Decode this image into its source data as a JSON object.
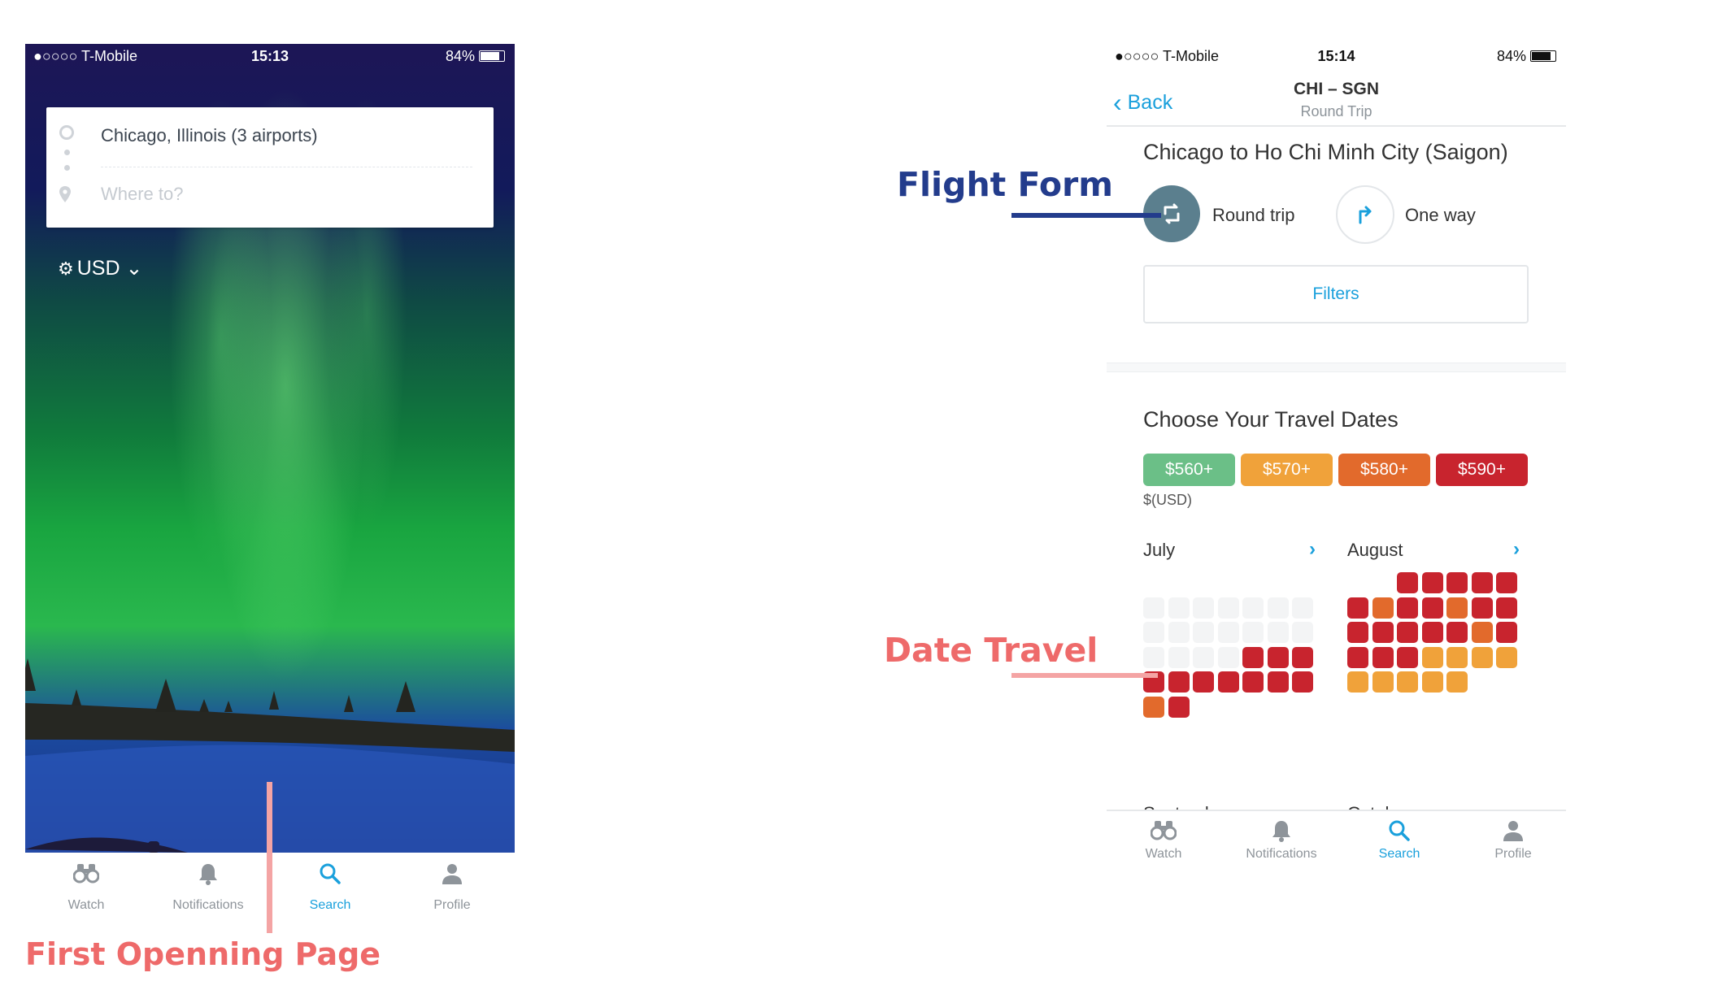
{
  "colors": {
    "accent": "#1aa0dc",
    "price_560": "#6bbf87",
    "price_570": "#f0a23a",
    "price_580": "#e26a2c",
    "price_590": "#c8242e",
    "empty": "#f3f4f5",
    "annotation_red": "#ee6a6a",
    "annotation_blue": "#233c8c",
    "round_trip_circle": "#5b7f8e"
  },
  "annotations": {
    "first_page": "First Openning Page",
    "flight_form": "Flight Form",
    "date_travel": "Date Travel"
  },
  "left": {
    "status": {
      "carrier": "●○○○○ T-Mobile",
      "time": "15:13",
      "battery": "84%"
    },
    "search": {
      "from": "Chicago, Illinois (3 airports)",
      "to_placeholder": "Where to?"
    },
    "currency": "USD",
    "tabs": [
      {
        "label": "Watch",
        "icon": "binoculars-icon"
      },
      {
        "label": "Notifications",
        "icon": "bell-icon"
      },
      {
        "label": "Search",
        "icon": "search-icon"
      },
      {
        "label": "Profile",
        "icon": "person-icon"
      }
    ]
  },
  "right": {
    "status": {
      "carrier": "●○○○○ T-Mobile",
      "time": "15:14",
      "battery": "84%"
    },
    "nav": {
      "back": "Back",
      "title": "CHI – SGN",
      "subtitle": "Round Trip"
    },
    "route": "Chicago to Ho Chi Minh City (Saigon)",
    "round_trip": "Round trip",
    "one_way": "One way",
    "filters": "Filters",
    "dates_title": "Choose Your Travel Dates",
    "legend": [
      "$560+",
      "$570+",
      "$580+",
      "$590+"
    ],
    "currency_note": "$(USD)",
    "months": {
      "july": "July",
      "august": "August",
      "september": "September",
      "october": "October"
    },
    "tabs": [
      {
        "label": "Watch",
        "icon": "binoculars-icon"
      },
      {
        "label": "Notifications",
        "icon": "bell-icon"
      },
      {
        "label": "Search",
        "icon": "search-icon"
      },
      {
        "label": "Profile",
        "icon": "person-icon"
      }
    ]
  }
}
